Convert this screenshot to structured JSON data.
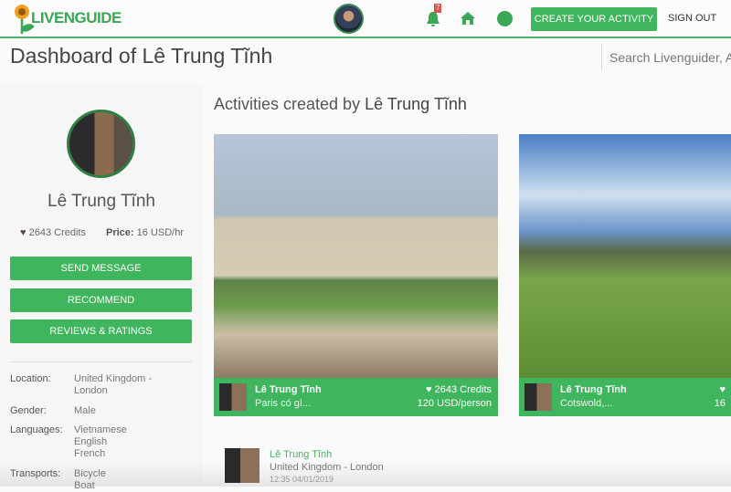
{
  "header": {
    "logo": "LIVENGUIDE",
    "notification_count": "7",
    "create_label": "CREATE YOUR ACTIVITY",
    "signout_label": "SIGN OUT",
    "accent": "#3fb55d",
    "icons": [
      "bell-icon",
      "home-icon",
      "globe-icon"
    ]
  },
  "page": {
    "title": "Dashboard of Lê Trung Tĩnh",
    "search_placeholder": "Search Livenguider, A"
  },
  "profile": {
    "name": "Lê Trung Tĩnh",
    "credits": "2643 Credits",
    "price_label": "Price:",
    "price_value": "16 USD/hr",
    "buttons": [
      "SEND MESSAGE",
      "RECOMMEND",
      "REVIEWS & RATINGS"
    ],
    "info": [
      {
        "label": "Location:",
        "value": [
          "United Kingdom -",
          "London"
        ]
      },
      {
        "label": "Gender:",
        "value": [
          "Male"
        ]
      },
      {
        "label": "Languages:",
        "value": [
          "Vietnamese",
          "English",
          "French"
        ]
      },
      {
        "label": "Transports:",
        "value": [
          "Bicycle",
          "Boat"
        ]
      }
    ]
  },
  "activities": {
    "heading_prefix": "Activities created by",
    "heading_name": "Lê Trung Tĩnh",
    "cards": [
      {
        "author": "Lê Trung Tĩnh",
        "desc": "Paris có gì...",
        "credits": "2643 Credits",
        "price": "120 USD/person"
      },
      {
        "author": "Lê Trung Tĩnh",
        "desc": "Cotswold,...",
        "credits": "",
        "price": "16"
      }
    ]
  },
  "comment": {
    "name": "Lê Trung Tĩnh",
    "location": "United Kingdom - London",
    "time": "12:35 04/01/2019"
  }
}
